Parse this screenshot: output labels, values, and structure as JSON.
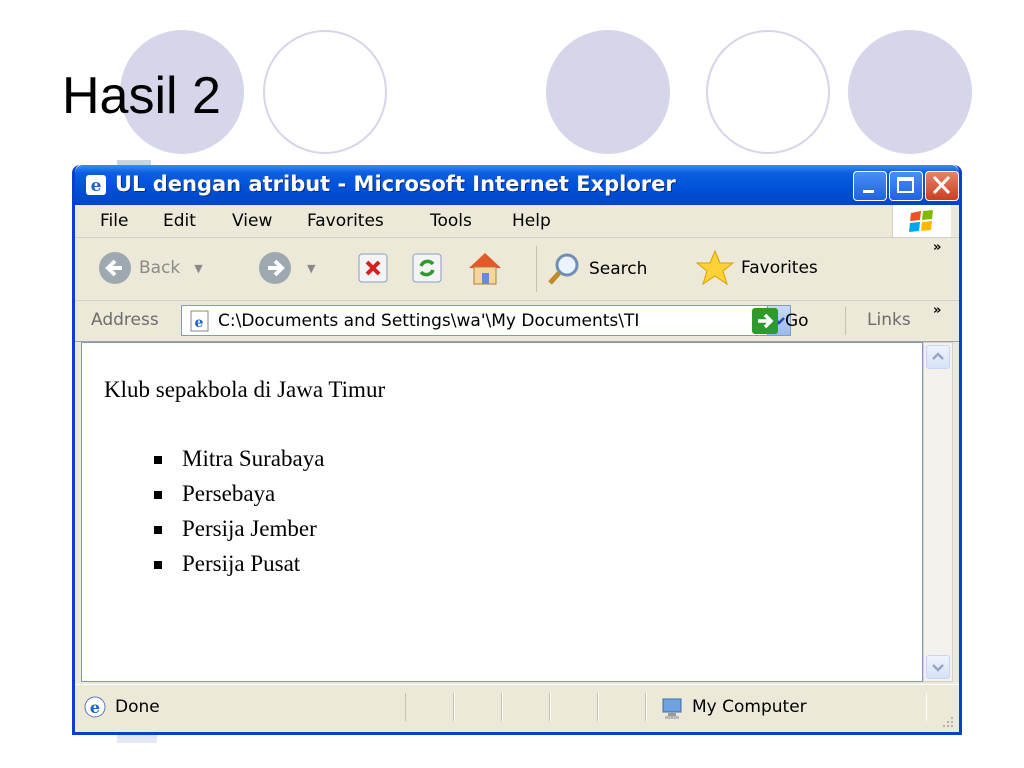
{
  "slide": {
    "title": "Hasil 2"
  },
  "window": {
    "title": "UL dengan atribut - Microsoft Internet Explorer",
    "menu": [
      "File",
      "Edit",
      "View",
      "Favorites",
      "Tools",
      "Help"
    ],
    "toolbar": {
      "back_label": "Back",
      "search_label": "Search",
      "favorites_label": "Favorites"
    },
    "address": {
      "label": "Address",
      "value": "C:\\Documents and Settings\\wa'\\My Documents\\TI",
      "go_label": "Go",
      "links_label": "Links"
    },
    "status": {
      "text": "Done",
      "zone": "My Computer"
    }
  },
  "page": {
    "heading": "Klub sepakbola di Jawa Timur",
    "items": [
      "Mitra Surabaya",
      "Persebaya",
      "Persija Jember",
      "Persija Pusat"
    ]
  },
  "colors": {
    "titlebar": "#0050d8",
    "decor_circle": "#d6d6ea"
  }
}
